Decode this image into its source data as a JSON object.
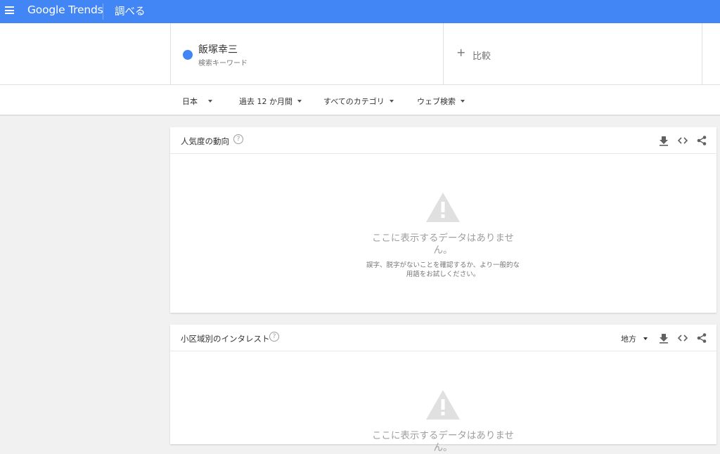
{
  "header": {
    "logo_text": "Google Trends",
    "page_title": "調べる"
  },
  "keyword": {
    "term": "飯塚幸三",
    "subtitle": "検索キーワード",
    "color": "#4285f4"
  },
  "compare": {
    "label": "比較"
  },
  "filters": {
    "region": "日本",
    "time": "過去 12 か月間",
    "category": "すべてのカテゴリ",
    "search_type": "ウェブ検索"
  },
  "cards": {
    "interest_over_time": {
      "title": "人気度の動向",
      "empty_title": "ここに表示するデータはありません。",
      "empty_sub": "誤字、脱字がないことを確認するか、より一般的な用語をお試しください。"
    },
    "interest_by_subregion": {
      "title": "小区域別のインタレスト",
      "resolution": "地方",
      "empty_title": "ここに表示するデータはありません。"
    }
  },
  "icons": {
    "menu": "menu-icon",
    "help": "help-icon",
    "download": "download-icon",
    "embed": "embed-code-icon",
    "share": "share-icon",
    "warning": "warning-icon"
  },
  "colors": {
    "topbar": "#4285f4",
    "background": "#f1f1f1",
    "warning_icon": "#e0e0e0"
  }
}
